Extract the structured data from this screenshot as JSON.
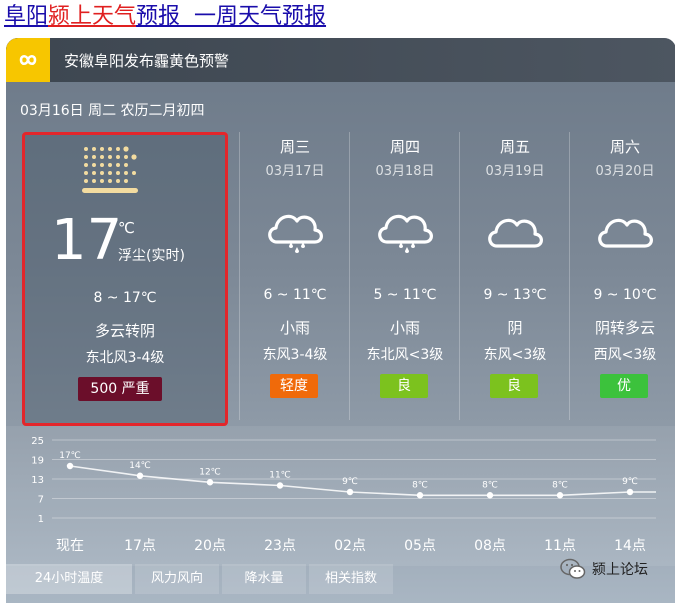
{
  "header": {
    "part1": "阜阳",
    "part2": "颍上天气",
    "part3": "预报  一周天气预报",
    "color_blue": "#1a0dab",
    "color_red": "#e02020"
  },
  "alert": {
    "icon": "infinity-icon",
    "text": "安徽阜阳发布霾黄色预警"
  },
  "date_line": "03月16日 周二 农历二月初四",
  "today": {
    "icon": "haze-icon",
    "temp": "17",
    "unit": "℃",
    "desc": "浮尘(实时)",
    "range": "8 ~ 17℃",
    "weather": "多云转阴",
    "wind": "东北风3-4级",
    "aqi": "500  严重",
    "aqi_color": "#6b0e2a"
  },
  "days": [
    {
      "name": "周三",
      "date": "03月17日",
      "icon": "rain-icon",
      "range": "6 ~ 11℃",
      "weather": "小雨",
      "wind": "东风3-4级",
      "aqi": "轻度",
      "aqi_color": "#f06a0a"
    },
    {
      "name": "周四",
      "date": "03月18日",
      "icon": "rain-icon",
      "range": "5 ~ 11℃",
      "weather": "小雨",
      "wind": "东北风<3级",
      "aqi": "良",
      "aqi_color": "#7cc21e"
    },
    {
      "name": "周五",
      "date": "03月19日",
      "icon": "cloud-icon",
      "range": "9 ~ 13℃",
      "weather": "阴",
      "wind": "东风<3级",
      "aqi": "良",
      "aqi_color": "#7cc21e"
    },
    {
      "name": "周六",
      "date": "03月20日",
      "icon": "cloud-icon",
      "range": "9 ~ 10℃",
      "weather": "阴转多云",
      "wind": "西风<3级",
      "aqi": "优",
      "aqi_color": "#3cc23c"
    }
  ],
  "chart_data": {
    "type": "line",
    "categories": [
      "现在",
      "17点",
      "20点",
      "23点",
      "02点",
      "05点",
      "08点",
      "11点",
      "14点"
    ],
    "values": [
      17,
      14,
      12,
      11,
      9,
      8,
      8,
      8,
      9
    ],
    "point_labels": [
      "17℃",
      "14℃",
      "12℃",
      "11℃",
      "9℃",
      "8℃",
      "8℃",
      "8℃",
      "9℃"
    ],
    "yticks": [
      "25",
      "19",
      "13",
      "7",
      "1"
    ],
    "ylim": [
      1,
      25
    ],
    "grid": true
  },
  "tabs": [
    "24小时温度",
    "风力风向",
    "降水量",
    "相关指数"
  ],
  "watermark": {
    "icon": "wechat-icon",
    "text": "颍上论坛"
  }
}
